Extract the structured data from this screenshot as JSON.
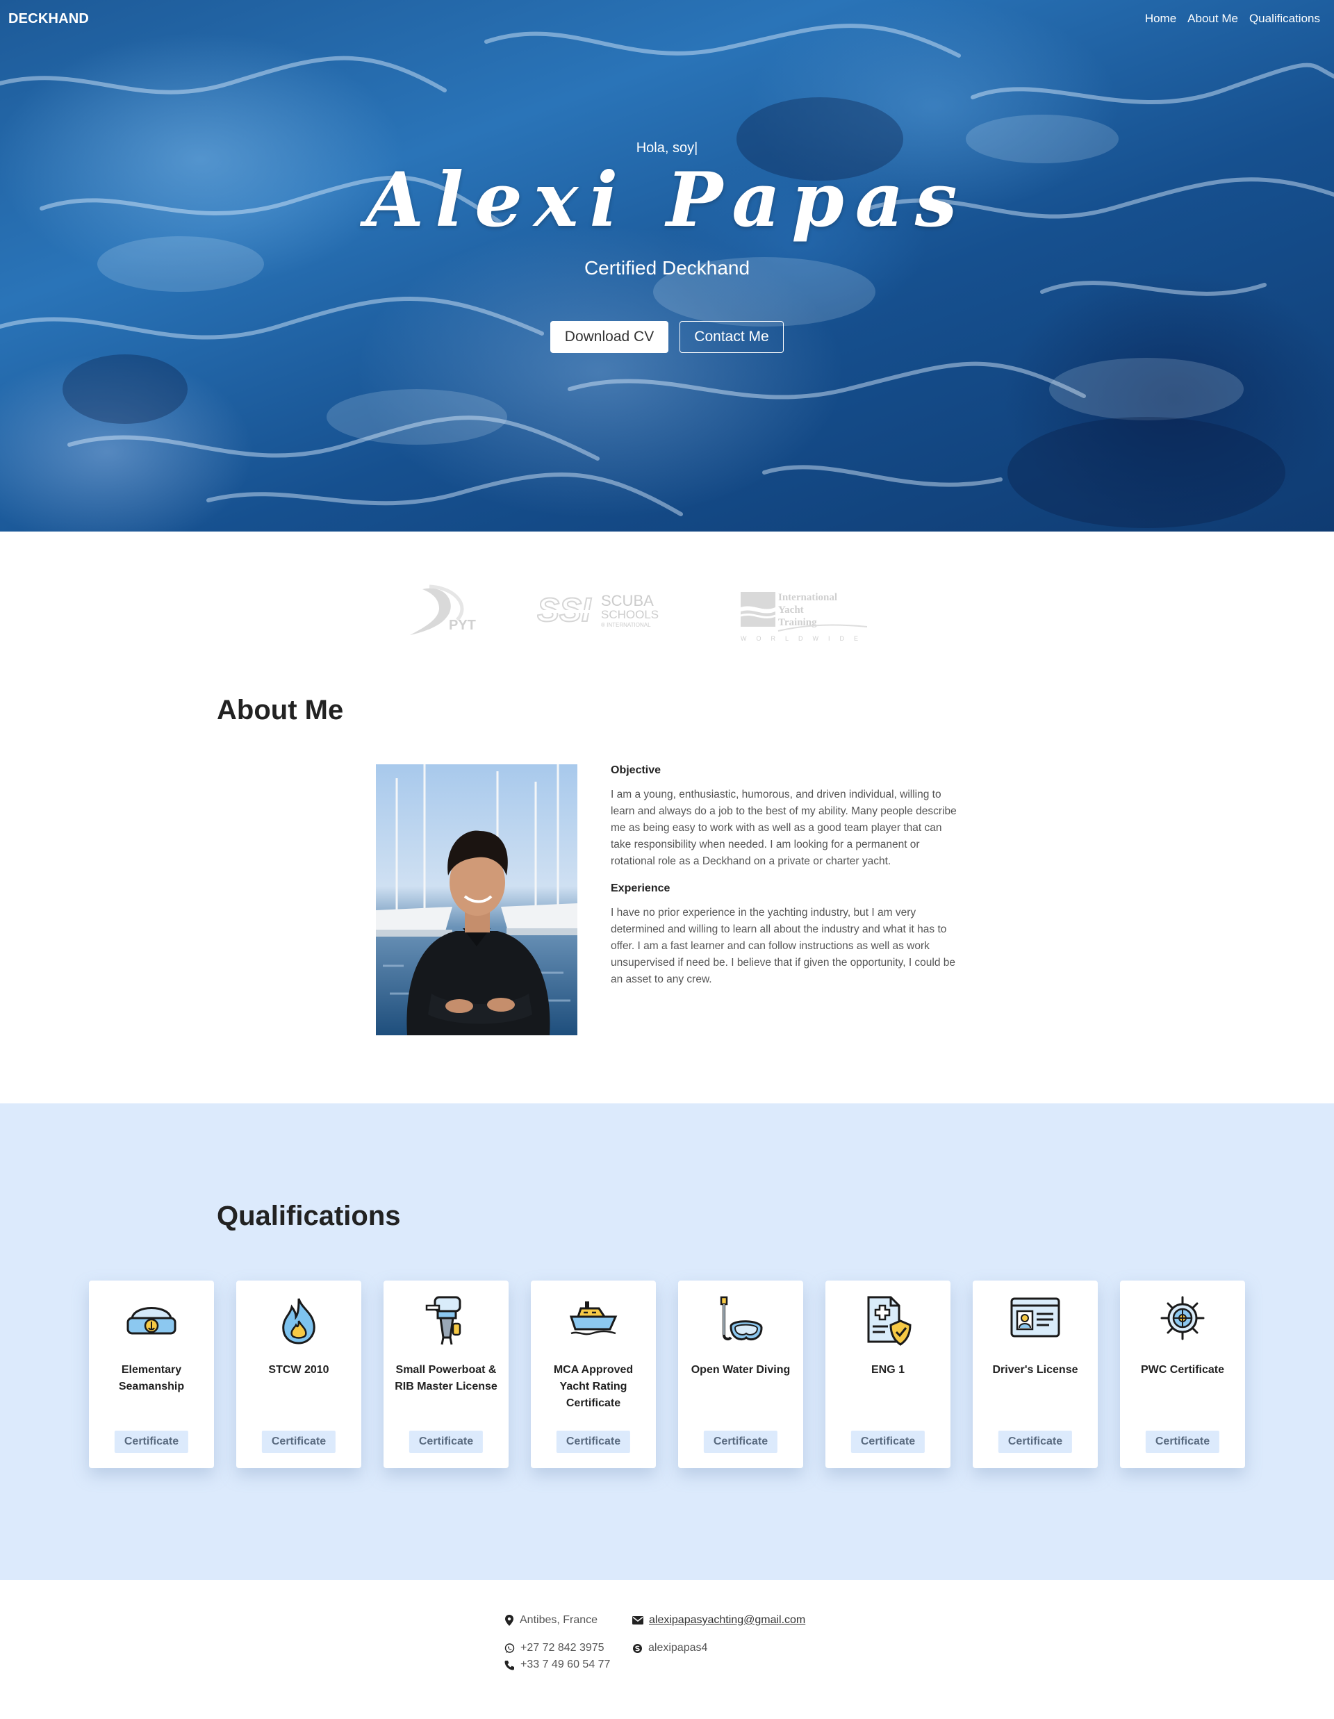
{
  "nav": {
    "brand": "DECKHAND",
    "links": [
      "Home",
      "About Me",
      "Qualifications"
    ]
  },
  "hero": {
    "greeting": "Hola, soy|",
    "name": "Alexi Papas",
    "role": "Certified Deckhand",
    "download_label": "Download CV",
    "contact_label": "Contact Me",
    "background": "ocean-water-image"
  },
  "partners": [
    {
      "name": "PYT",
      "icon": "pyt-logo"
    },
    {
      "name": "SCUBA SCHOOLS INTERNATIONAL",
      "icon": "ssi-logo"
    },
    {
      "name": "International Yacht Training WORLDWIDE",
      "icon": "iyt-logo"
    }
  ],
  "about": {
    "title": "About Me",
    "photo": "profile-photo",
    "objective_heading": "Objective",
    "objective_text": "I am a young, enthusiastic, humorous, and driven individual, willing to learn and always do a job to the best of my ability. Many people describe me as being easy to work with as well as a good team player that can take responsibility when needed. I am looking for a permanent or rotational role as a Deckhand on a private or charter yacht.",
    "experience_heading": "Experience",
    "experience_text": "I have no prior experience in the yachting industry, but I am very determined and willing to learn all about the industry and what it has to offer. I am a fast learner and can follow instructions as well as work unsupervised if need be. I believe that if given the opportunity, I could be an asset to any crew."
  },
  "qualifications": {
    "title": "Qualifications",
    "background_color": "#dceafc",
    "button_label": "Certificate",
    "items": [
      {
        "title": "Elementary Seamanship",
        "icon": "sailor-hat-icon"
      },
      {
        "title": "STCW 2010",
        "icon": "fire-icon"
      },
      {
        "title": "Small Powerboat & RIB Master License",
        "icon": "outboard-motor-icon"
      },
      {
        "title": "MCA Approved Yacht Rating Certificate",
        "icon": "yacht-icon"
      },
      {
        "title": "Open Water Diving",
        "icon": "snorkel-mask-icon"
      },
      {
        "title": "ENG 1",
        "icon": "medical-document-icon"
      },
      {
        "title": "Driver's License",
        "icon": "id-card-icon"
      },
      {
        "title": "PWC Certificate",
        "icon": "ship-wheel-icon"
      }
    ]
  },
  "footer": {
    "location": "Antibes, France",
    "email": "alexipapasyachting@gmail.com",
    "whatsapp": "+27 72 842 3975",
    "phone": "+33 7 49 60 54 77",
    "skype": "alexipapas4"
  }
}
